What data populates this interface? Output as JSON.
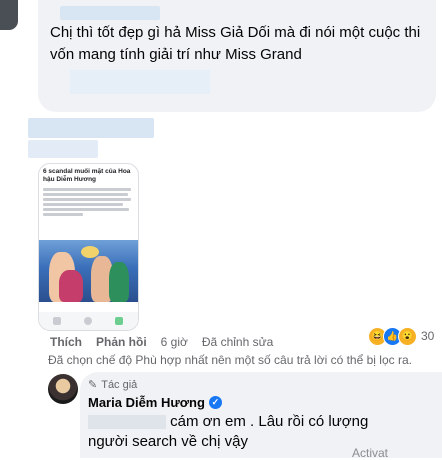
{
  "comment1": {
    "text": "Chị thì tốt đẹp gì hả Miss Giả Dối mà đi nói một cuộc thi vốn mang tính giải trí như Miss Grand"
  },
  "comment2": {
    "image": {
      "title": "6 scandal muối mặt của Hoa hậu Diễm Hương"
    },
    "actions": {
      "like": "Thích",
      "reply": "Phản hồi",
      "time": "6 giờ",
      "edited": "Đã chỉnh sửa"
    },
    "reactions": {
      "count": "30"
    }
  },
  "notice": "Đã chọn chế độ Phù hợp nhất nên một số câu trả lời có thể bị lọc ra.",
  "reply": {
    "author_tag": "Tác giả",
    "name": "Maria Diễm Hương",
    "text": "cám ơn em . Lâu rồi có lượng người search về chị vậy"
  },
  "watermark": "Activat"
}
